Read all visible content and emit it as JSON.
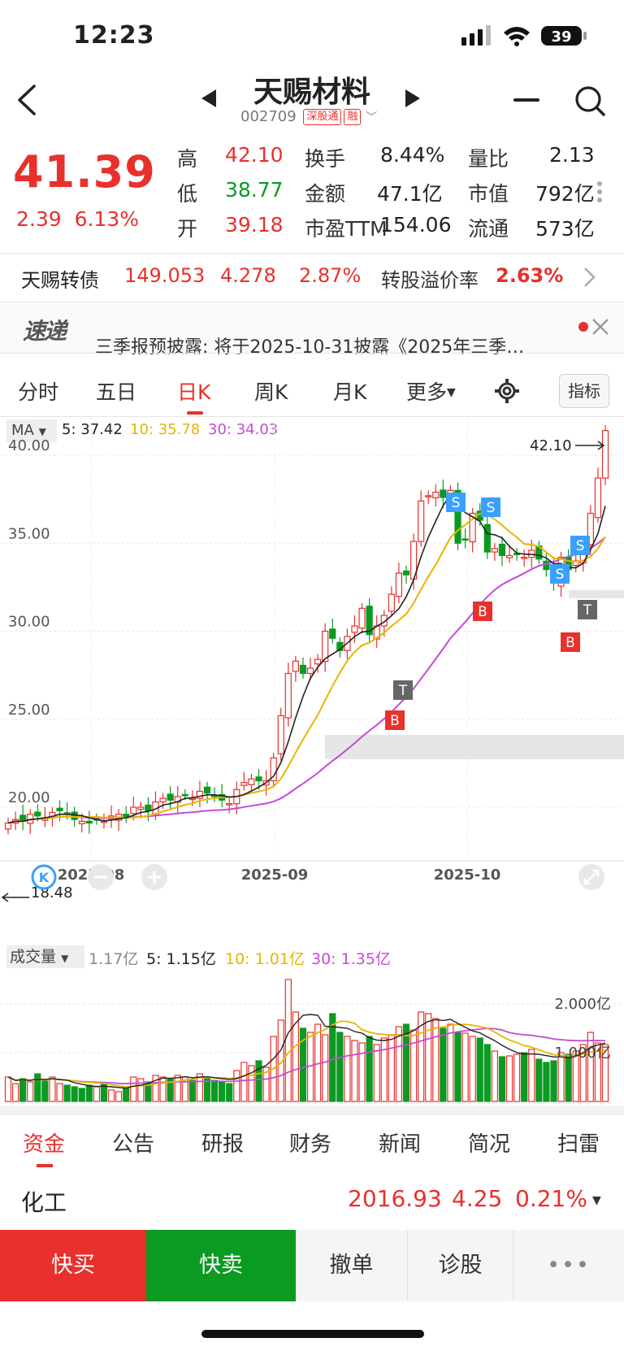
{
  "status": {
    "time": "12:23",
    "battery": "39"
  },
  "header": {
    "name": "天赐材料",
    "code": "002709",
    "tag1": "深股通",
    "tag2": "融"
  },
  "quote": {
    "price": "41.39",
    "change": "2.39",
    "pct": "6.13%",
    "rows": [
      [
        {
          "label": "高",
          "value": "42.10",
          "color": "red"
        },
        {
          "label": "换手",
          "value": "8.44%"
        },
        {
          "label": "量比",
          "value": "2.13"
        }
      ],
      [
        {
          "label": "低",
          "value": "38.77",
          "color": "green"
        },
        {
          "label": "金额",
          "value": "47.1亿"
        },
        {
          "label": "市值",
          "value": "792亿"
        }
      ],
      [
        {
          "label": "开",
          "value": "39.18",
          "color": "red"
        },
        {
          "label": "市盈TTM",
          "value": "154.06"
        },
        {
          "label": "流通",
          "value": "573亿"
        }
      ]
    ]
  },
  "convertible": {
    "name": "天赐转债",
    "price": "149.053",
    "change": "4.278",
    "pct": "2.87%",
    "premium_label": "转股溢价率",
    "premium": "2.63%"
  },
  "news": {
    "logo": "速递",
    "text": "三季报预披露: 将于2025-10-31披露《2025年三季…"
  },
  "tabs": {
    "t1": "分时",
    "t2": "五日",
    "t3": "日K",
    "t4": "周K",
    "t5": "月K",
    "t6": "更多",
    "indicator": "指标"
  },
  "ma": {
    "label": "MA",
    "ma5": "5: 37.42",
    "ma10": "10: 35.78",
    "ma30": "30: 34.03"
  },
  "chart_data": {
    "type": "candlestick",
    "y_ticks": [
      "40.00",
      "35.00",
      "30.00",
      "25.00",
      "20.00"
    ],
    "x_ticks": [
      "2025-08",
      "2025-09",
      "2025-10"
    ],
    "high_label": "42.10",
    "low_label": "18.48",
    "ylim": [
      18.0,
      42.6
    ],
    "vol_label": "成交量",
    "vol_total": "1.17亿",
    "vol_ma5": "5: 1.15亿",
    "vol_ma10": "10: 1.01亿",
    "vol_ma30": "30: 1.35亿",
    "vol_ticks": [
      "2.000亿",
      "1.000亿"
    ],
    "signals": [
      "S",
      "S",
      "S",
      "S",
      "B",
      "B",
      "B",
      "T",
      "T"
    ]
  },
  "bottom_tabs": {
    "b1": "资金",
    "b2": "公告",
    "b3": "研报",
    "b4": "财务",
    "b5": "新闻",
    "b6": "简况",
    "b7": "扫雷"
  },
  "industry": {
    "name": "化工",
    "price": "2016.93",
    "change": "4.25",
    "pct": "0.21%"
  },
  "actions": {
    "buy": "快买",
    "sell": "快卖",
    "cancel": "撤单",
    "diag": "诊股",
    "more": "•••"
  },
  "colors": {
    "up": "#e8302c",
    "down": "#0b9a22",
    "ma5": "#222222",
    "ma10": "#e6b500",
    "ma30": "#c64ad6"
  }
}
